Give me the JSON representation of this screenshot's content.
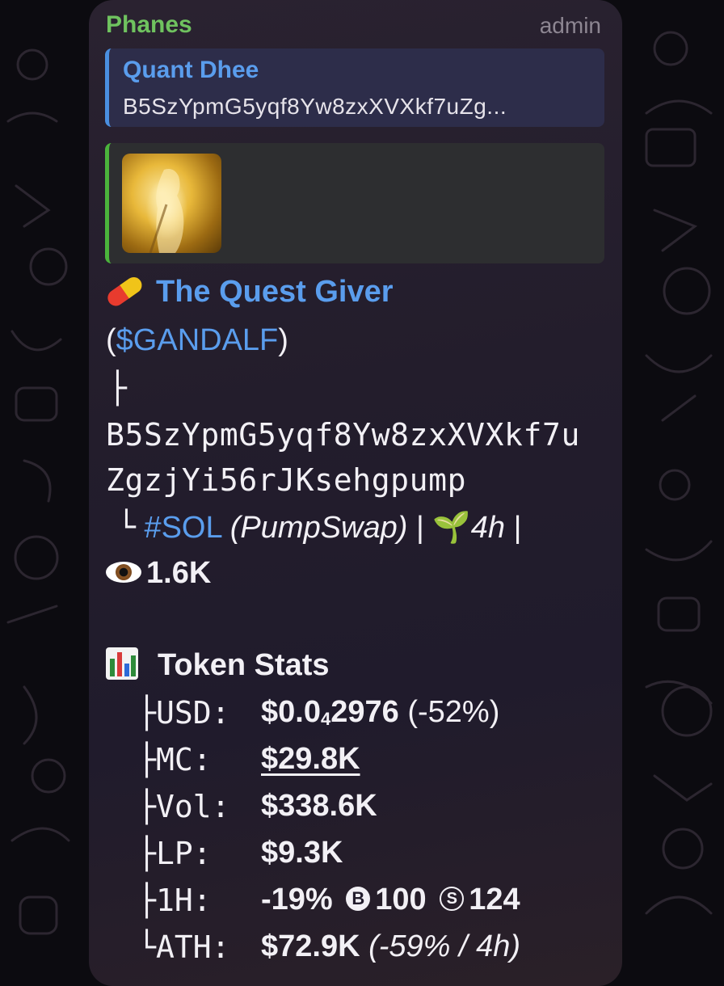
{
  "message": {
    "sender": "Phanes",
    "role": "admin",
    "reply": {
      "name": "Quant Dhee",
      "text": "B5SzYpmG5yqf8Yw8zxXVXkf7uZg..."
    },
    "preview": {
      "image": "golden-glowing-figure-thumbnail"
    },
    "token": {
      "pill_emoji": "pill-emoji",
      "name": "The Quest Giver",
      "ticker_open": "(",
      "ticker": "$GANDALF",
      "ticker_close": ")",
      "branch_glyph": "├",
      "address_line1": "B5SzYpmG5yqf8Yw8zxXVXkf7u",
      "address_line2": "ZgzjYi56rJKsehgpump",
      "chain_glyph": "└",
      "chain": "#SOL",
      "dex": "(PumpSwap)",
      "sep1": "|",
      "sprout_emoji": "🌱",
      "age": "4h",
      "sep2": "|",
      "eye_emoji": "eye-emoji",
      "views": "1.6K"
    },
    "stats": {
      "header_icon": "bar-chart-emoji",
      "header": "Token Stats",
      "rows": [
        {
          "tree": "├",
          "label": "USD:",
          "value_main": "$0.0",
          "value_sub": "4",
          "value_rest": "2976",
          "value_extra": "(-52%)"
        },
        {
          "tree": "├",
          "label": "MC:",
          "value": "$29.8K"
        },
        {
          "tree": "├",
          "label": "Vol:",
          "value": "$338.6K"
        },
        {
          "tree": "├",
          "label": "LP:",
          "value": "$9.3K"
        },
        {
          "tree": "├",
          "label": "1H:",
          "pct": "-19%",
          "b_glyph": "B",
          "b_value": "100",
          "s_glyph": "S",
          "s_value": "124"
        },
        {
          "tree": "└",
          "label": "ATH:",
          "value": "$72.9K",
          "extra": "(-59% / 4h)"
        }
      ]
    }
  }
}
